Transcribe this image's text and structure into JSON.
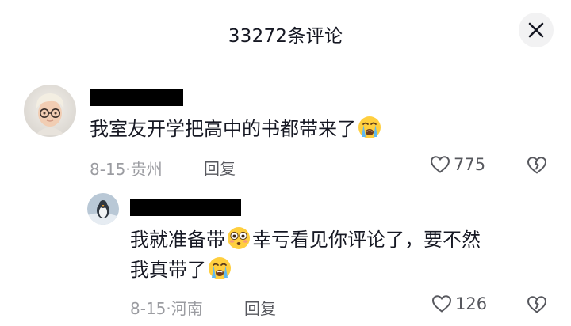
{
  "header": {
    "title": "33272条评论"
  },
  "comments": [
    {
      "text_parts": [
        "我室友开学把高中的书都带来了"
      ],
      "emoji": "loudly-crying-face",
      "date": "8-15",
      "separator": "·",
      "location": "贵州",
      "reply_label": "回复",
      "likes": "775"
    },
    {
      "line1_before": "我就准备带",
      "line1_after": "幸亏看见你评论了，要不然",
      "line2": "我真带了",
      "emojis": [
        "flushed-face",
        "loudly-crying-face"
      ],
      "date": "8-15",
      "separator": "·",
      "location": "河南",
      "reply_label": "回复",
      "likes": "126"
    }
  ],
  "colors": {
    "text": "#161823",
    "meta": "#9b9ca1",
    "action": "#57585e",
    "close_bg": "#f2f2f3"
  }
}
